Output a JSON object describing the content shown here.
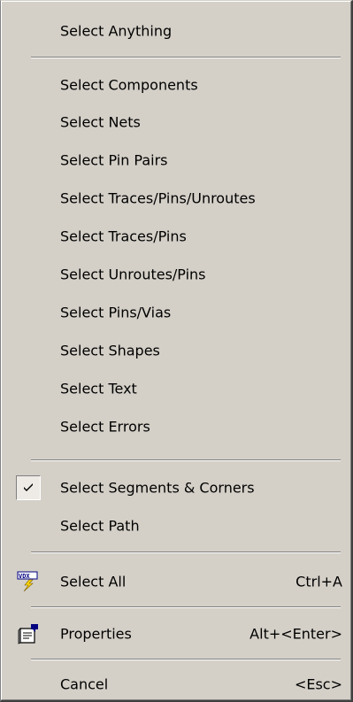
{
  "menu": {
    "items": {
      "select_anything": "Select Anything",
      "select_components": "Select Components",
      "select_nets": "Select Nets",
      "select_pin_pairs": "Select Pin Pairs",
      "select_traces_pins_unroutes": "Select Traces/Pins/Unroutes",
      "select_traces_pins": "Select Traces/Pins",
      "select_unroutes_pins": "Select Unroutes/Pins",
      "select_pins_vias": "Select Pins/Vias",
      "select_shapes": "Select Shapes",
      "select_text": "Select Text",
      "select_errors": "Select Errors",
      "select_segments_corners": "Select Segments & Corners",
      "select_path": "Select Path",
      "select_all": "Select All",
      "properties": "Properties",
      "cancel": "Cancel"
    },
    "shortcuts": {
      "select_all": "Ctrl+A",
      "properties": "Alt+<Enter>",
      "cancel": "<Esc>"
    },
    "checked_item": "select_segments_corners",
    "icons": {
      "select_all": "select-all-icon",
      "properties": "properties-icon"
    },
    "colors": {
      "menu_background": "#d4d0c8",
      "text": "#000000"
    }
  }
}
